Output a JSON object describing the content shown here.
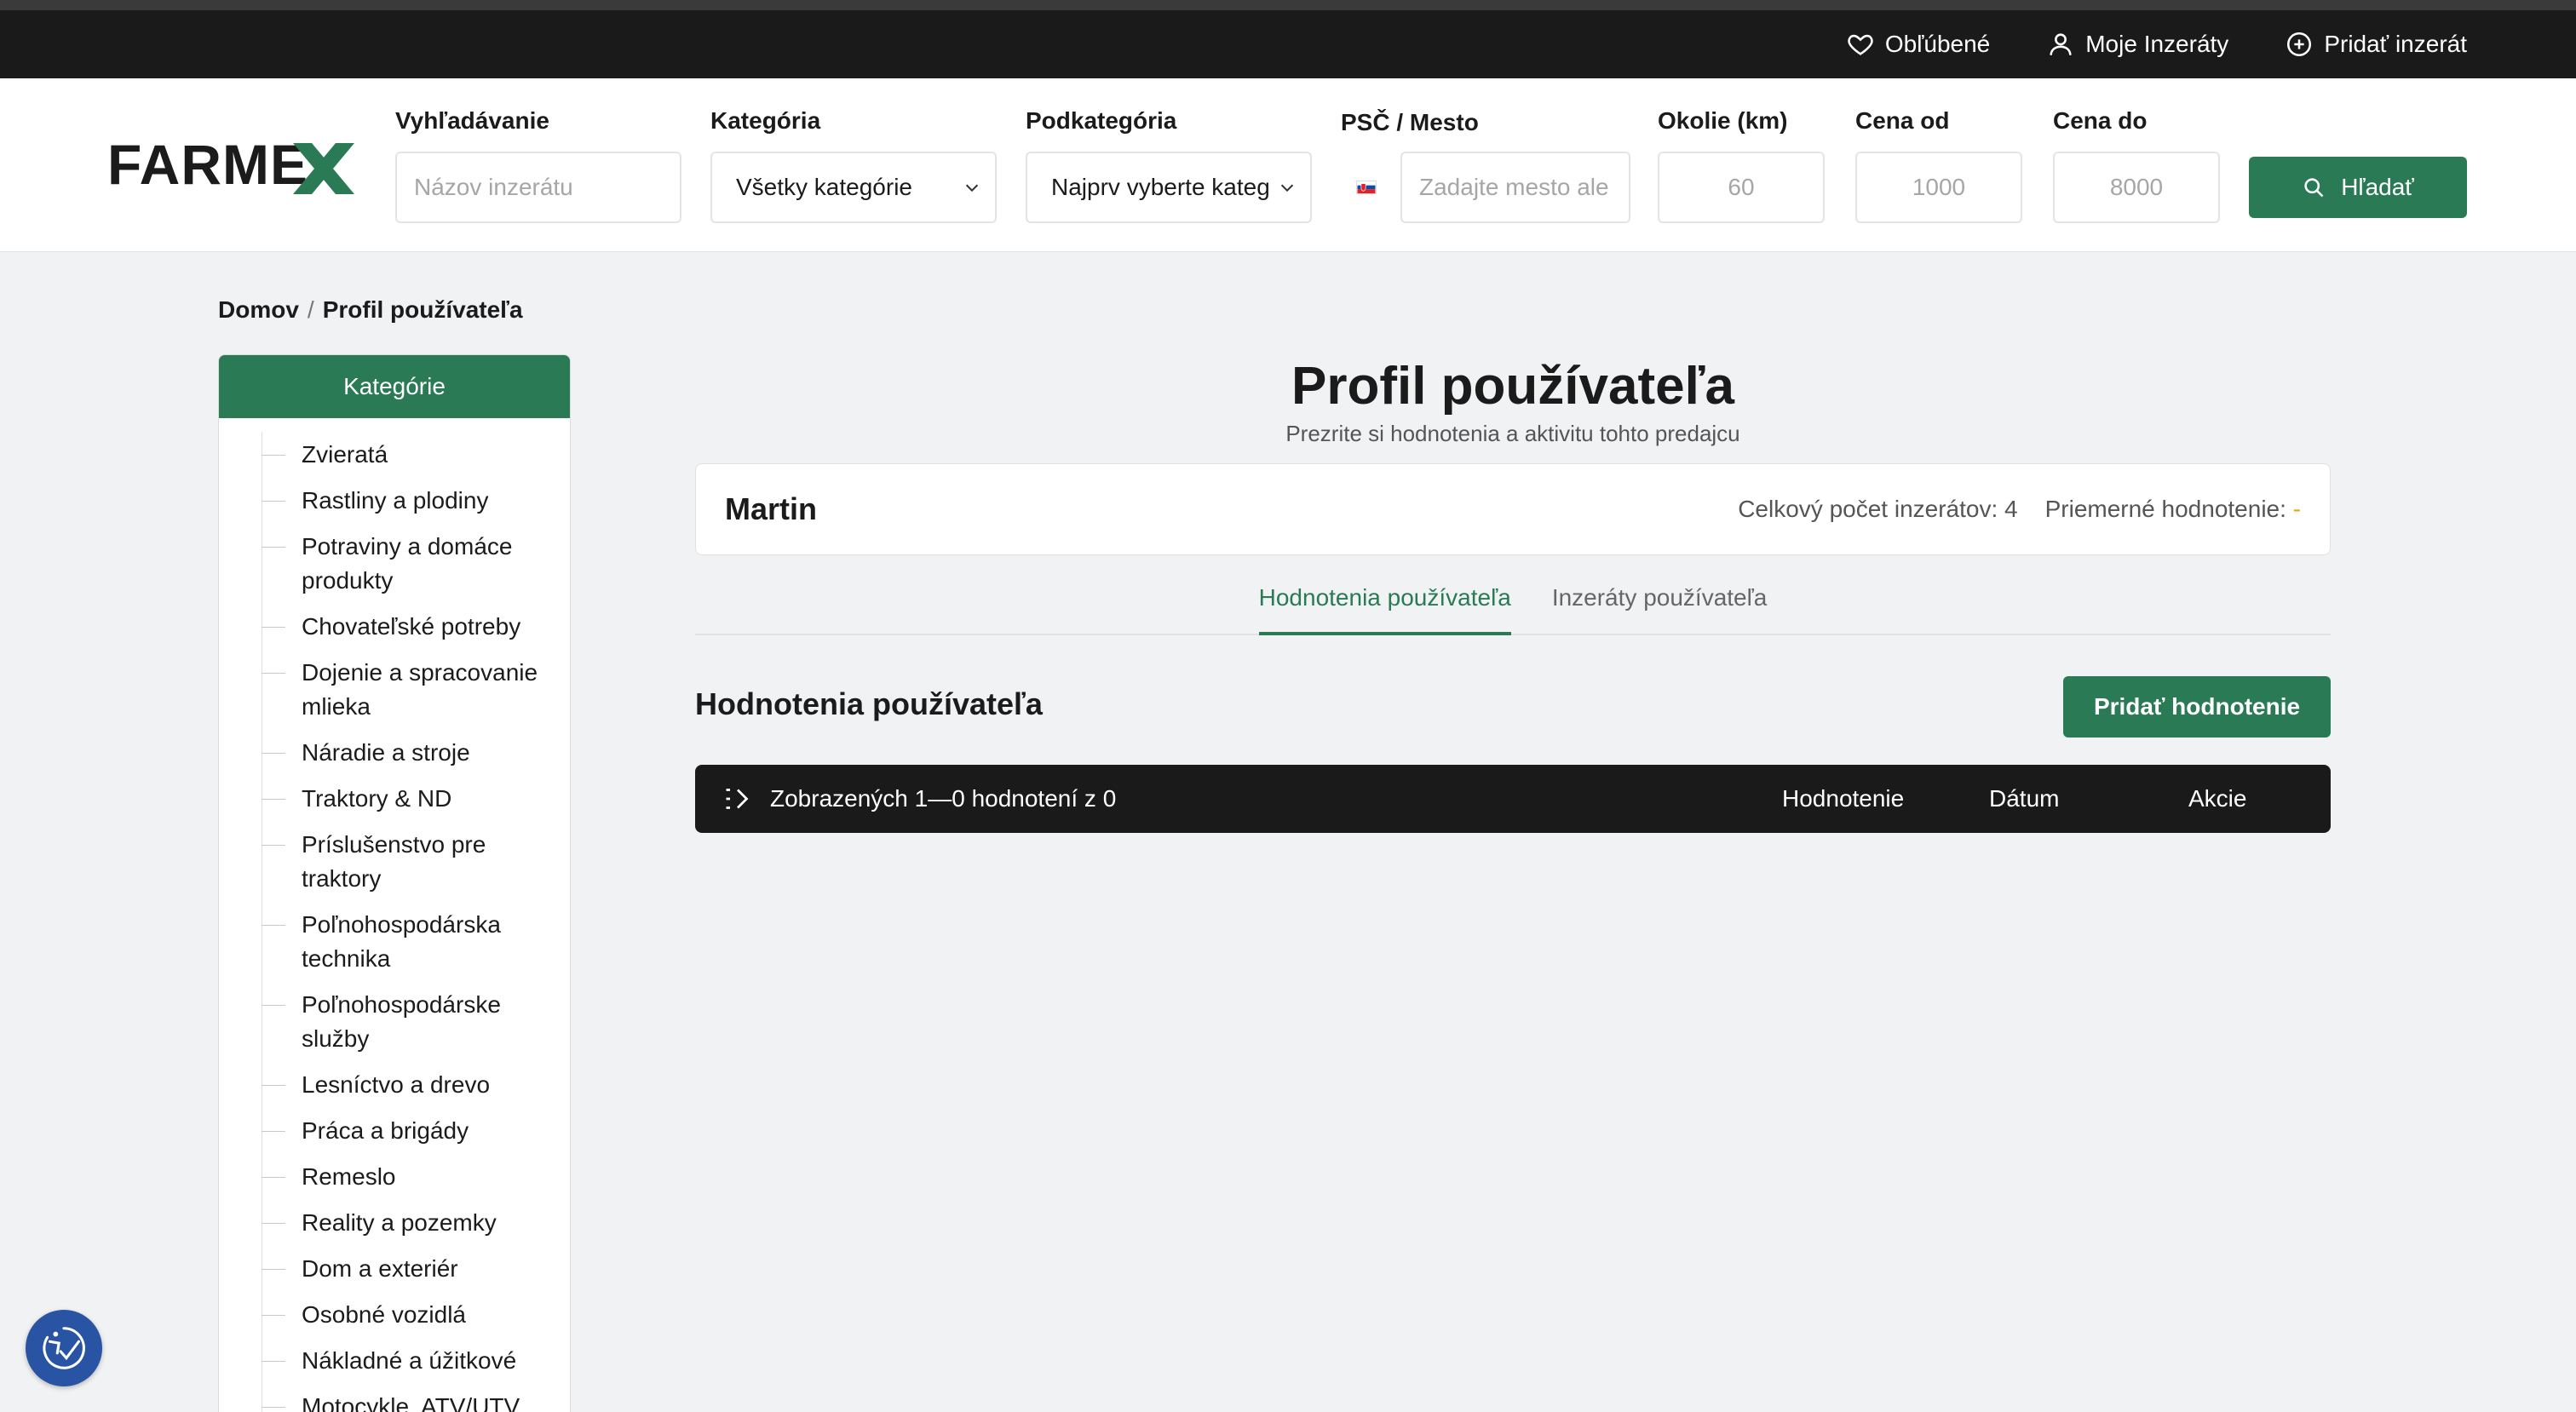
{
  "topbar": {
    "favorites_label": "Obľúbené",
    "my_listings_label": "Moje Inzeráty",
    "add_listing_label": "Pridať inzerát"
  },
  "logo": {
    "text": "FARMEX",
    "accent_letter": "X",
    "accent_color": "#2a7a55"
  },
  "search": {
    "query_label": "Vyhľadávanie",
    "query_placeholder": "Názov inzerátu",
    "category_label": "Kategória",
    "category_value": "Všetky kategórie",
    "subcategory_label": "Podkategória",
    "subcategory_value": "Najprv vyberte kateg",
    "location_label": "PSČ / Mesto",
    "location_placeholder": "Zadajte mesto ale",
    "radius_label": "Okolie (km)",
    "radius_placeholder": "60",
    "price_from_label": "Cena od",
    "price_from_placeholder": "1000",
    "price_to_label": "Cena do",
    "price_to_placeholder": "8000",
    "button_label": "Hľadať"
  },
  "breadcrumb": {
    "home": "Domov",
    "separator": "/",
    "current": "Profil používateľa"
  },
  "sidebar": {
    "title": "Kategórie",
    "items": [
      "Zvieratá",
      "Rastliny a plodiny",
      "Potraviny a domáce produkty",
      "Chovateľské potreby",
      "Dojenie a spracovanie mlieka",
      "Náradie a stroje",
      "Traktory & ND",
      "Príslušenstvo pre traktory",
      "Poľnohospodárska technika",
      "Poľnohospodárske služby",
      "Lesníctvo a drevo",
      "Práca a brigády",
      "Remeslo",
      "Reality a pozemky",
      "Dom a exteriér",
      "Osobné vozidlá",
      "Nákladné a úžitkové",
      "Motocykle, ATV/UTV"
    ]
  },
  "profile": {
    "title": "Profil používateľa",
    "subtitle": "Prezrite si hodnotenia a aktivitu tohto predajcu",
    "user_name": "Martin",
    "listings_count_label": "Celkový počet inzerátov: 4",
    "avg_rating_label": "Priemerné hodnotenie:",
    "avg_rating_value": "-"
  },
  "tabs": [
    {
      "label": "Hodnotenia používateľa",
      "active": true
    },
    {
      "label": "Inzeráty používateľa",
      "active": false
    }
  ],
  "reviews": {
    "section_title": "Hodnotenia používateľa",
    "add_button_label": "Pridať hodnotenie",
    "summary": "Zobrazených 1—0 hodnotení z 0",
    "columns": [
      "Hodnotenie",
      "Dátum",
      "Akcie"
    ]
  },
  "colors": {
    "brand_green": "#2a7a55",
    "dark": "#1a1a1a",
    "a11y_blue": "#2954a3"
  }
}
